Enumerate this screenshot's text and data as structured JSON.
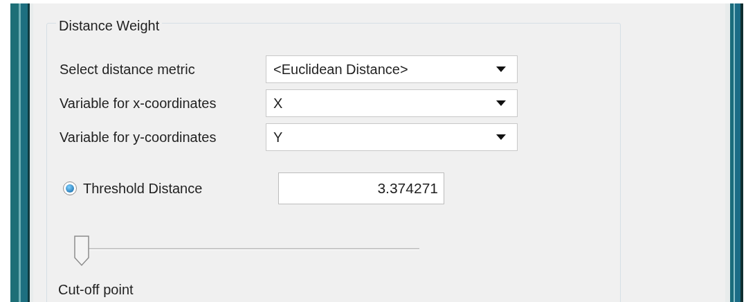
{
  "group": {
    "title": "Distance Weight"
  },
  "fields": [
    {
      "label": "Select distance metric",
      "value": "<Euclidean Distance>"
    },
    {
      "label": "Variable for x-coordinates",
      "value": "X"
    },
    {
      "label": "Variable for y-coordinates",
      "value": "Y"
    }
  ],
  "threshold": {
    "label": "Threshold Distance",
    "selected": true,
    "value": "3.374271"
  },
  "slider": {
    "level": 0.0,
    "label": "Cut-off point"
  }
}
